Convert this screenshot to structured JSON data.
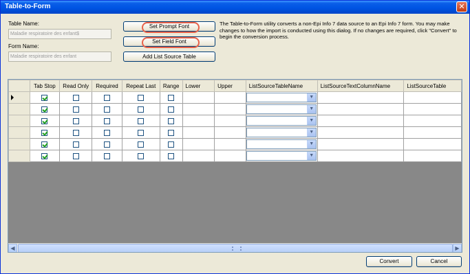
{
  "window": {
    "title": "Table-to-Form",
    "close_glyph": "✕"
  },
  "form": {
    "table_name_label": "Table Name:",
    "table_name_value": "Maladie respiratoire des enfant$",
    "form_name_label": "Form Name:",
    "form_name_value": "Maladie respiratoire des enfant"
  },
  "buttons": {
    "set_prompt_font": "Set Prompt Font",
    "set_field_font": "Set Field Font",
    "add_list_source_table": "Add List Source Table",
    "convert": "Convert",
    "cancel": "Cancel"
  },
  "instructions": "The Table-to-Form utility converts a non-Epi Info 7 data source to an Epi Info 7 form. You may make changes to how the import is conducted using this dialog. If no changes are required, click \"Convert\" to begin the conversion process.",
  "grid": {
    "columns": [
      "Tab Stop",
      "Read Only",
      "Required",
      "Repeat Last",
      "Range",
      "Lower",
      "Upper",
      "ListSourceTableName",
      "ListSourceTextColumnName",
      "ListSourceTable"
    ],
    "rows": [
      {
        "tab_stop": true,
        "read_only": false,
        "required": false,
        "repeat_last": false,
        "range": false,
        "current": true
      },
      {
        "tab_stop": true,
        "read_only": false,
        "required": false,
        "repeat_last": false,
        "range": false,
        "current": false
      },
      {
        "tab_stop": true,
        "read_only": false,
        "required": false,
        "repeat_last": false,
        "range": false,
        "current": false
      },
      {
        "tab_stop": true,
        "read_only": false,
        "required": false,
        "repeat_last": false,
        "range": false,
        "current": false
      },
      {
        "tab_stop": true,
        "read_only": false,
        "required": false,
        "repeat_last": false,
        "range": false,
        "current": false
      },
      {
        "tab_stop": true,
        "read_only": false,
        "required": false,
        "repeat_last": false,
        "range": false,
        "current": false
      }
    ],
    "icons": {
      "dropdown": "chevron-down-icon",
      "scroll_left": "arrow-left-icon",
      "scroll_right": "arrow-right-icon",
      "row_pointer": "row-pointer-icon"
    }
  },
  "colors": {
    "titlebar": "#0054e3",
    "window_bg": "#ece9d8",
    "highlight_ring": "#e8624a",
    "grid_bg": "#888888"
  }
}
